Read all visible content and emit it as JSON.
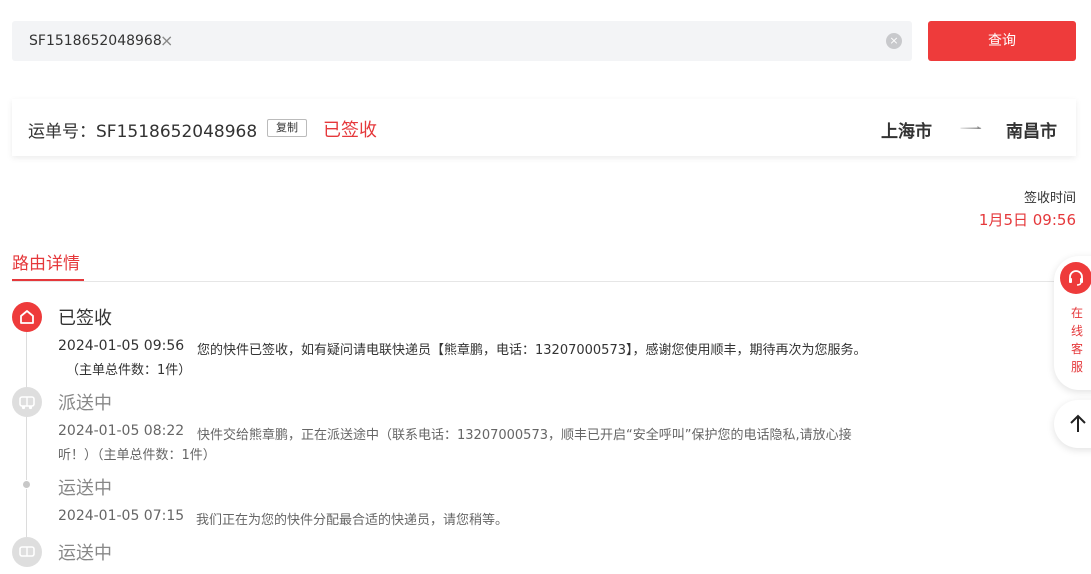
{
  "search": {
    "tag_value": "SF1518652048968",
    "tag_remove_icon": "close-icon",
    "clear_icon": "clear-circle-icon",
    "button_label": "查询"
  },
  "waybill": {
    "label": "运单号：SF1518652048968",
    "copy_label": "复制",
    "status": "已签收",
    "from_city": "上海市",
    "to_city": "南昌市",
    "route_icon": "arrow-right-icon"
  },
  "sign": {
    "label": "签收时间",
    "value": "1月5日 09:56"
  },
  "tab": {
    "label": "路由详情"
  },
  "timeline": [
    {
      "status": "已签收",
      "icon": "house-icon",
      "time": "2024-01-05 09:56",
      "desc": "您的快件已签收，如有疑问请电联快递员【熊章鹏，电话：13207000573】，感谢您使用顺丰，期待再次为您服务。",
      "desc_cont": "（主单总件数：1件）"
    },
    {
      "status": "派送中",
      "icon": "truck-icon",
      "time": "2024-01-05 08:22",
      "desc": "快件交给熊章鹏，正在派送途中（联系电话：13207000573，顺丰已开启“安全呼叫”保护您的电话隐私,请放心接",
      "desc_cont": "听！）（主单总件数：1件）"
    },
    {
      "status": "运送中",
      "icon": "dot",
      "time": "2024-01-05 07:15",
      "desc": "我们正在为您的快件分配最合适的快递员，请您稍等。"
    },
    {
      "status": "运送中",
      "icon": "truck-icon"
    }
  ],
  "floating": {
    "cs_label": "在线客服",
    "cs_icon": "headset-icon",
    "top_icon": "arrow-up-icon"
  },
  "colors": {
    "accent": "#ee3b3b",
    "status_red": "#e5383b",
    "input_bg": "#f3f4f6"
  }
}
